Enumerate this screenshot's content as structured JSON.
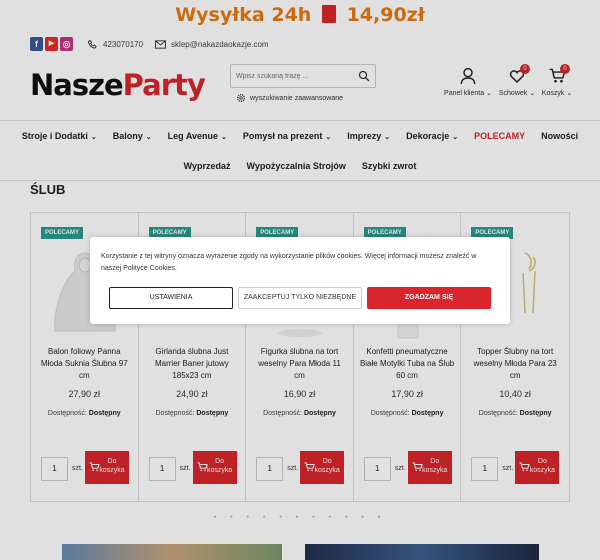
{
  "banner": {
    "left": "Wysyłka 24h",
    "right": "14,90zł",
    "bag_text": "DELIVERY"
  },
  "topbar": {
    "phone": "423070170",
    "email": "sklep@nakazdaokazje.com",
    "social": [
      {
        "icon": "facebook-icon",
        "letter": "f",
        "color": "#3b5998"
      },
      {
        "icon": "youtube-icon",
        "letter": "▶",
        "color": "#e52d27"
      },
      {
        "icon": "instagram-icon",
        "letter": "◎",
        "color": "#c13584"
      }
    ]
  },
  "logo": {
    "part1": "Nasze",
    "part2": "Party"
  },
  "search": {
    "placeholder": "Wpisz szukaną frazę ...",
    "advanced": "wyszukiwanie zaawansowane"
  },
  "header_icons": [
    {
      "icon": "user-icon",
      "label": "Panel klienta",
      "badge": ""
    },
    {
      "icon": "heart-icon",
      "label": "Schowek",
      "badge": "0"
    },
    {
      "icon": "cart-icon",
      "label": "Koszyk",
      "badge": "0"
    }
  ],
  "nav": {
    "row1": [
      {
        "label": "Stroje i Dodatki",
        "chevron": true
      },
      {
        "label": "Balony",
        "chevron": true
      },
      {
        "label": "Leg Avenue",
        "chevron": true
      },
      {
        "label": "Pomysł na prezent",
        "chevron": true
      },
      {
        "label": "Imprezy",
        "chevron": true
      },
      {
        "label": "Dekoracje",
        "chevron": true
      },
      {
        "label": "POLECAMY",
        "chevron": false,
        "accent": true
      },
      {
        "label": "Nowości",
        "chevron": false
      }
    ],
    "row2": [
      {
        "label": "Wyprzedaż"
      },
      {
        "label": "Wypożyczalnia Strojów"
      },
      {
        "label": "Szybki zwrot"
      }
    ]
  },
  "section_title": "ŚLUB",
  "products": [
    {
      "tag": "POLECAMY",
      "name": "Balon foliowy Panna Młoda Suknia Ślubna 97 cm",
      "price": "27,90 zł",
      "avail_label": "Dostępność:",
      "avail_value": "Dostępny",
      "qty": "1",
      "unit": "szt.",
      "buy": "Do koszyka"
    },
    {
      "tag": "POLECAMY",
      "name": "Girlanda ślubna Just Marrier Baner jutowy 185x23 cm",
      "price": "24,90 zł",
      "avail_label": "Dostępność:",
      "avail_value": "Dostępny",
      "qty": "1",
      "unit": "szt.",
      "buy": "Do koszyka"
    },
    {
      "tag": "POLECAMY",
      "name": "Figurka ślubna na tort weselny Para Młoda 11 cm",
      "price": "16,90 zł",
      "avail_label": "Dostępność:",
      "avail_value": "Dostępny",
      "qty": "1",
      "unit": "szt.",
      "buy": "Do koszyka"
    },
    {
      "tag": "POLECAMY",
      "name": "Konfetti pneumatyczne Białe Motylki Tuba na Ślub 60 cm",
      "price": "17,90 zł",
      "avail_label": "Dostępność:",
      "avail_value": "Dostępny",
      "qty": "1",
      "unit": "szt.",
      "buy": "Do koszyka"
    },
    {
      "tag": "POLECAMY",
      "name": "Topper Ślubny na tort weselny Młoda Para 23 cm",
      "price": "10,40 zł",
      "avail_label": "Dostępność:",
      "avail_value": "Dostępny",
      "qty": "1",
      "unit": "szt.",
      "buy": "Do koszyka"
    }
  ],
  "cookie": {
    "message": "Korzystanie z tej witryny oznacza wyrażenie zgody na wykorzystanie plików cookies. Więcej informacji możesz znaleźć w naszej Polityce Cookies.",
    "settings": "USTAWIENIA",
    "necessary": "ZAAKCEPTUJ TYLKO NIEZBĘDNE",
    "accept": "ZGADZAM SIĘ"
  },
  "colors": {
    "accent": "#d9262c",
    "banner": "#e57a14",
    "tag": "#2a9d8f"
  }
}
